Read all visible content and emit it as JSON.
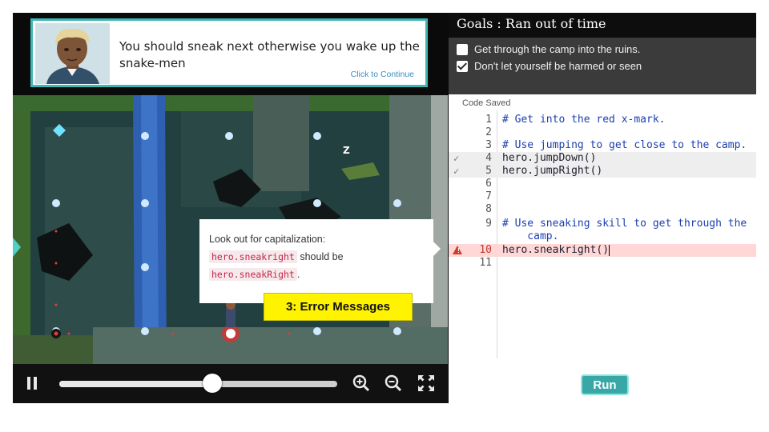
{
  "dialog": {
    "message": "You should sneak next otherwise you wake up the snake-men",
    "continue_label": "Click to Continue"
  },
  "goals": {
    "title": "Goals : Ran out of time",
    "items": [
      {
        "label": "Get through the camp into the ruins.",
        "checked": false
      },
      {
        "label": "Don't let yourself be harmed or seen",
        "checked": true
      }
    ]
  },
  "hint": {
    "line1": "Look out for capitalization:",
    "wrong_code": "hero.sneakright",
    "should_be": "should be",
    "right_code": "hero.sneakRight",
    "period": "."
  },
  "callout": {
    "label": "3: Error Messages"
  },
  "sleep_marker": "Z",
  "playback": {
    "progress": 0.55
  },
  "icons": {
    "pause": "pause-icon",
    "zoom_in": "zoom-in-icon",
    "zoom_out": "zoom-out-icon",
    "fullscreen": "fullscreen-icon"
  },
  "editor": {
    "status": "Code Saved",
    "lines": [
      {
        "num": "1",
        "text": "# Get into the red x-mark.",
        "kind": "comment"
      },
      {
        "num": "2",
        "text": "",
        "kind": "plain"
      },
      {
        "num": "3",
        "text": "# Use jumping to get close to the camp.",
        "kind": "comment"
      },
      {
        "num": "4",
        "text": "hero.jumpDown()",
        "kind": "plain",
        "status": "ok"
      },
      {
        "num": "5",
        "text": "hero.jumpRight()",
        "kind": "plain",
        "status": "ok"
      },
      {
        "num": "6",
        "text": "",
        "kind": "plain"
      },
      {
        "num": "7",
        "text": "",
        "kind": "plain"
      },
      {
        "num": "8",
        "text": "",
        "kind": "plain"
      },
      {
        "num": "9",
        "text": "# Use sneaking skill to get through the",
        "kind": "comment"
      },
      {
        "num": "",
        "text": "    camp.",
        "kind": "comment"
      },
      {
        "num": "10",
        "text": "hero.sneakright()",
        "kind": "plain",
        "status": "error"
      },
      {
        "num": "11",
        "text": "",
        "kind": "plain"
      }
    ],
    "run_label": "Run"
  },
  "colors": {
    "accent": "#3fb7b7",
    "error_row": "#ffd7d7",
    "callout": "#fff300",
    "comment": "#1c3fae"
  }
}
